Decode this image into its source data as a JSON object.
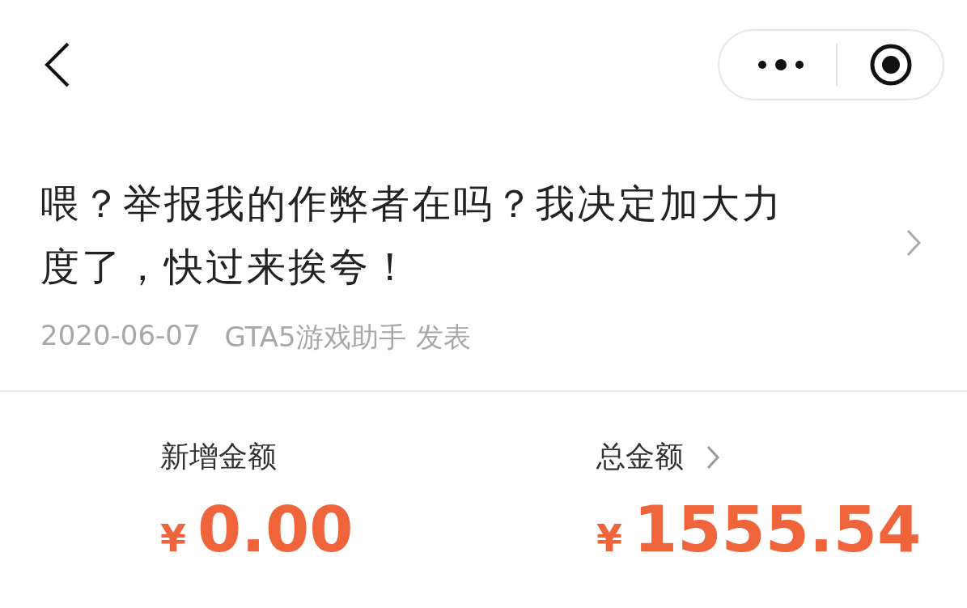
{
  "title": "喂？举报我的作弊者在吗？我决定加大力度了，快过来挨夸！",
  "meta": {
    "date": "2020-06-07",
    "author": "GTA5游戏助手",
    "action": "发表"
  },
  "stats": [
    {
      "label": "新增金额",
      "link": false,
      "currency": "¥",
      "amount": "0.00"
    },
    {
      "label": "总金额",
      "link": true,
      "currency": "¥",
      "amount": "1555.54"
    }
  ]
}
